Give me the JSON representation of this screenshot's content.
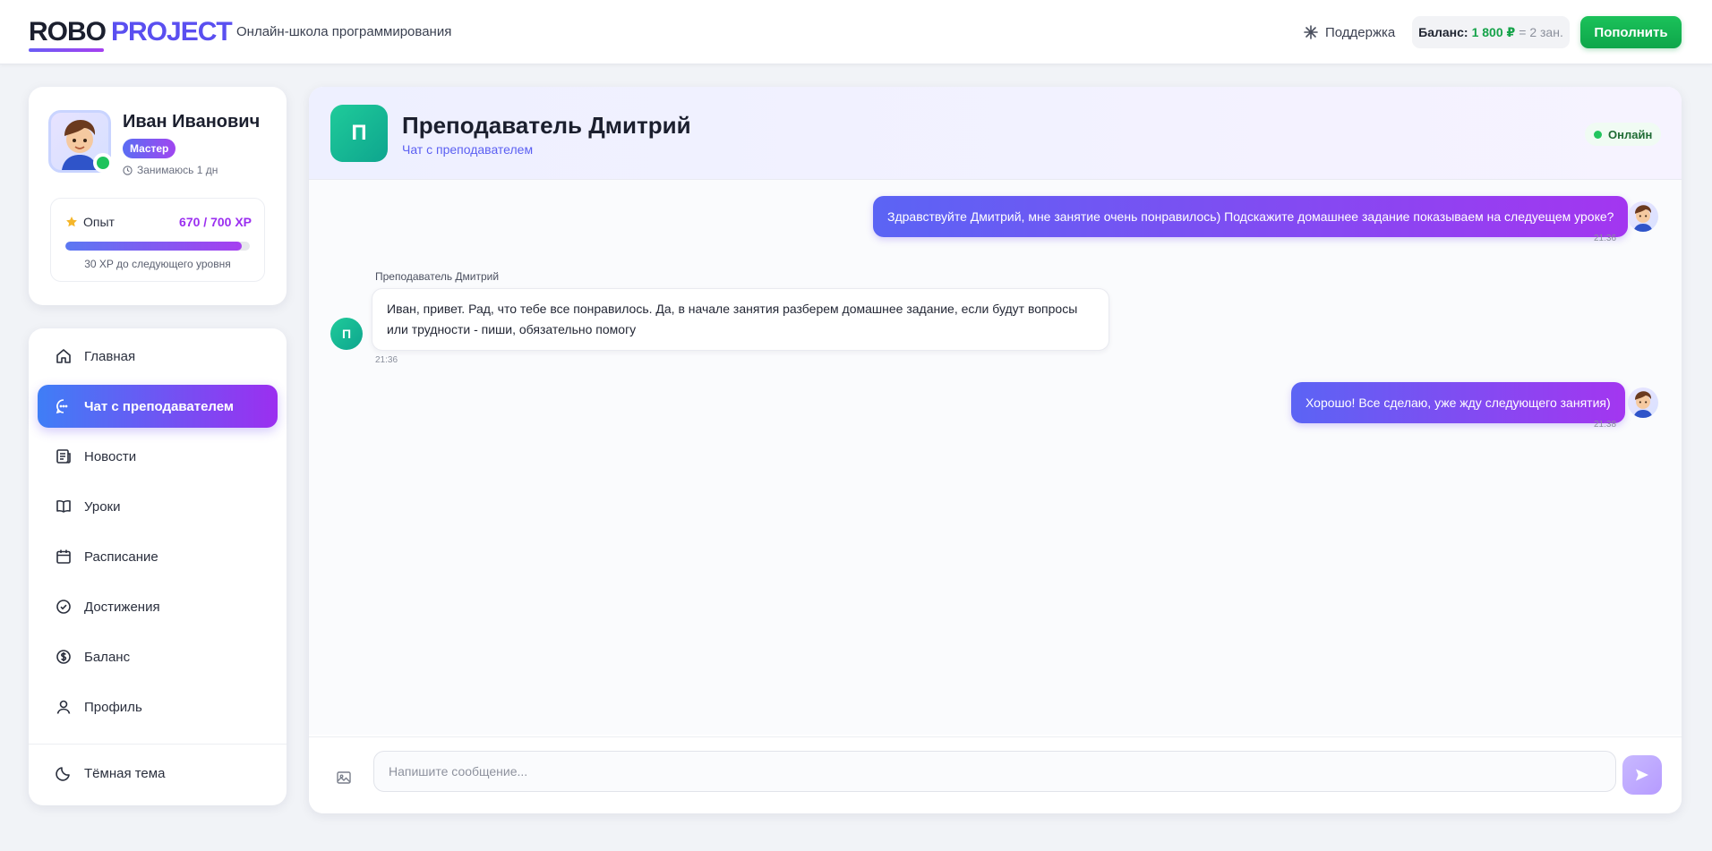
{
  "header": {
    "logo_part1": "ROBO",
    "logo_part2": "PROJECT",
    "tagline": "Онлайн-школа программирования",
    "support_label": "Поддержка",
    "balance_label": "Баланс:",
    "balance_value": "1 800 ₽",
    "balance_equiv": "= 2 зан.",
    "topup_label": "Пополнить"
  },
  "profile": {
    "name": "Иван Иванович",
    "rank": "Мастер",
    "since": "Занимаюсь 1 дн",
    "xp_label": "Опыт",
    "xp_value": "670 / 700 XP",
    "xp_progress": 0.957,
    "xp_next": "30 XP до следующего уровня"
  },
  "nav": {
    "items": [
      {
        "label": "Главная"
      },
      {
        "label": "Чат с преподавателем"
      },
      {
        "label": "Новости"
      },
      {
        "label": "Уроки"
      },
      {
        "label": "Расписание"
      },
      {
        "label": "Достижения"
      },
      {
        "label": "Баланс"
      },
      {
        "label": "Профиль"
      }
    ],
    "theme_label": "Тёмная тема"
  },
  "chat": {
    "teacher_initial": "П",
    "teacher_name": "Преподаватель Дмитрий",
    "subtitle": "Чат с преподавателем",
    "status": "Онлайн",
    "messages": [
      {
        "text": "Здравствуйте Дмитрий, мне занятие очень понравилось) Подскажите домашнее задание показываем на следуещем уроке?",
        "time": "21:36"
      },
      {
        "sender": "Преподаватель Дмитрий",
        "initial": "П",
        "text": "Иван, привет. Рад, что тебе все понравилось. Да, в начале занятия разберем домашнее задание, если будут вопросы или трудности - пиши, обязательно помогу",
        "time": "21:36"
      },
      {
        "text": "Хорошо! Все сделаю, уже жду следующего занятия)",
        "time": "21:38"
      }
    ],
    "input_placeholder": "Напишите сообщение..."
  },
  "colors": {
    "accent_blue": "#3f7ef6",
    "accent_purple": "#9b2ff0",
    "success_green": "#16a34a",
    "teacher_teal": "#14b89a"
  }
}
